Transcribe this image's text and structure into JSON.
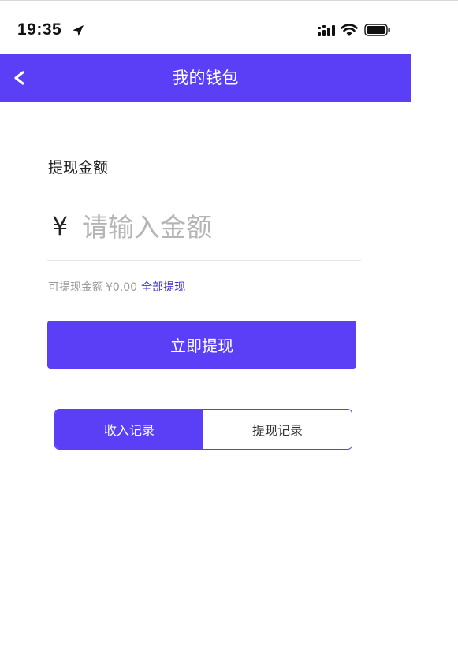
{
  "status_bar": {
    "time": "19:35",
    "icons": [
      "location-arrow-icon",
      "signal-icon",
      "wifi-icon",
      "battery-icon"
    ]
  },
  "nav": {
    "back_label": "<",
    "title": "我的钱包"
  },
  "withdraw": {
    "section_label": "提现金额",
    "currency_symbol": "¥",
    "input_placeholder": "请输入金额",
    "input_value": "",
    "available_label": "可提现金额",
    "available_amount": "¥0.00",
    "withdraw_all_label": "全部提现",
    "submit_label": "立即提现"
  },
  "tabs": [
    {
      "label": "收入记录",
      "active": true
    },
    {
      "label": "提现记录",
      "active": false
    }
  ],
  "colors": {
    "accent": "#5a3ff6",
    "link": "#3b2fc9",
    "placeholder": "#b5b5b5",
    "muted_text": "#9a9a9a"
  }
}
